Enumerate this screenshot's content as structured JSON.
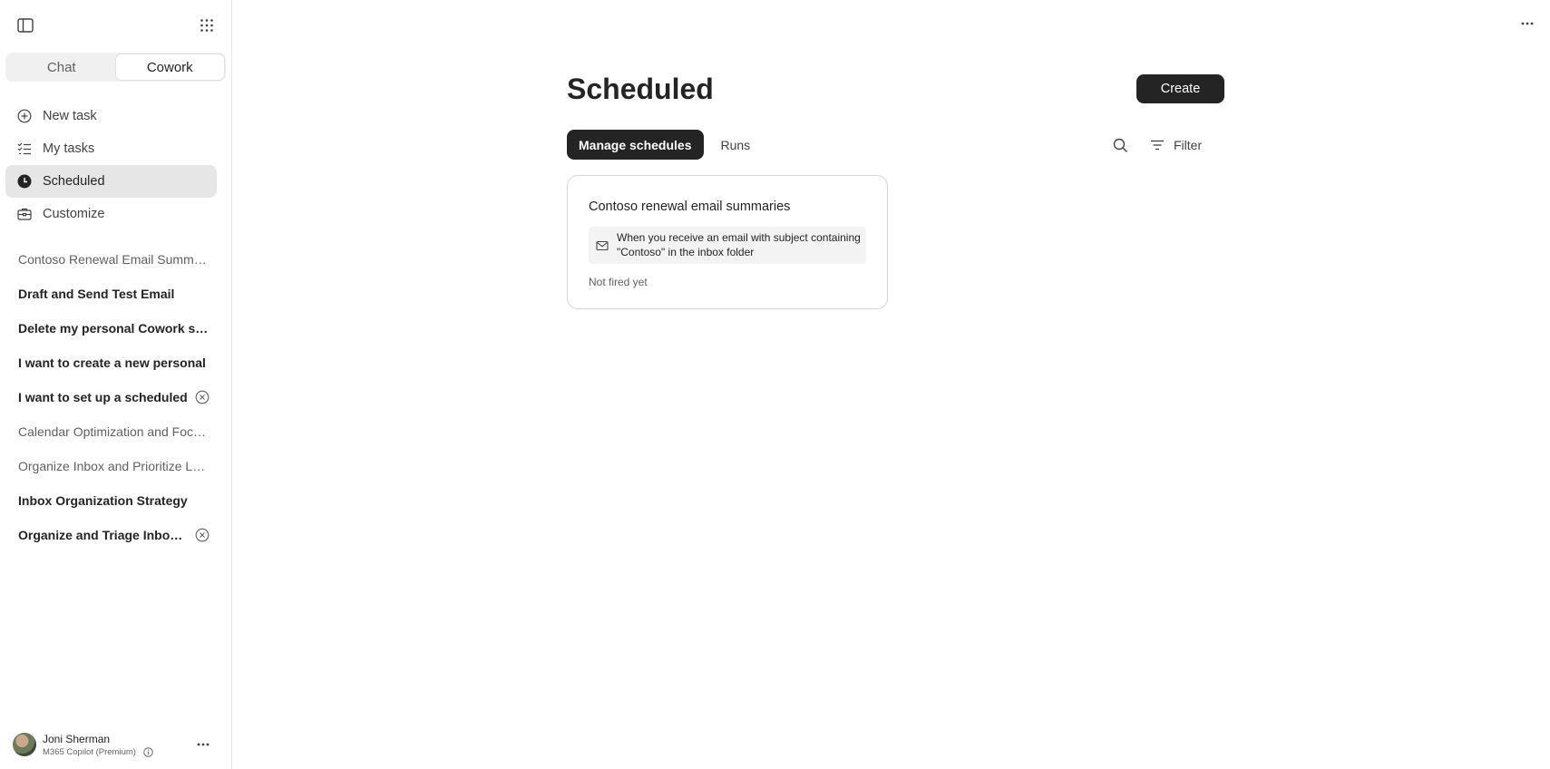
{
  "sidebar": {
    "toggle": {
      "chat": "Chat",
      "cowork": "Cowork"
    },
    "nav": [
      {
        "label": "New task",
        "icon": "plus-circle-icon"
      },
      {
        "label": "My tasks",
        "icon": "task-list-icon"
      },
      {
        "label": "Scheduled",
        "icon": "clock-icon"
      },
      {
        "label": "Customize",
        "icon": "briefcase-icon"
      }
    ],
    "recents": [
      "Contoso Renewal Email Summar...",
      "Draft and Send Test Email",
      "Delete my personal Cowork skil...",
      "I want to create a new personal",
      "I want to set up a scheduled",
      "Calendar Optimization and Focu...",
      "Organize Inbox and Prioritize Le...",
      "Inbox Organization Strategy",
      "Organize and Triage Inbox ..."
    ],
    "user": {
      "name": "Joni Sherman",
      "plan": "M365 Copilot (Premium)"
    }
  },
  "main": {
    "title": "Scheduled",
    "create_label": "Create",
    "tabs": [
      "Manage schedules",
      "Runs"
    ],
    "filter_label": "Filter",
    "cards": [
      {
        "title": "Contoso renewal email summaries",
        "trigger": "When you receive an email with subject containing \"Contoso\" in the inbox folder",
        "status": "Not fired yet"
      }
    ]
  },
  "colors": {
    "accent": "#242424",
    "active_nav": "#e6e6e6",
    "trigger_bg": "#f3f3f3"
  }
}
